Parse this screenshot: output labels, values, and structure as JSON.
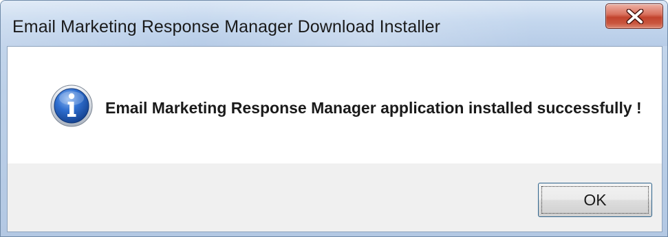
{
  "window": {
    "title": "Email Marketing Response Manager Download Installer"
  },
  "titlebar": {
    "close_icon": "close-x-icon"
  },
  "dialog": {
    "icon": "information-icon",
    "message": "Email Marketing Response Manager application installed successfully !",
    "ok_label": "OK"
  },
  "colors": {
    "close_button": "#c9563f",
    "info_icon": "#1f5fbf",
    "button_border": "#2c628b",
    "footer_background": "#f0f0f0"
  }
}
